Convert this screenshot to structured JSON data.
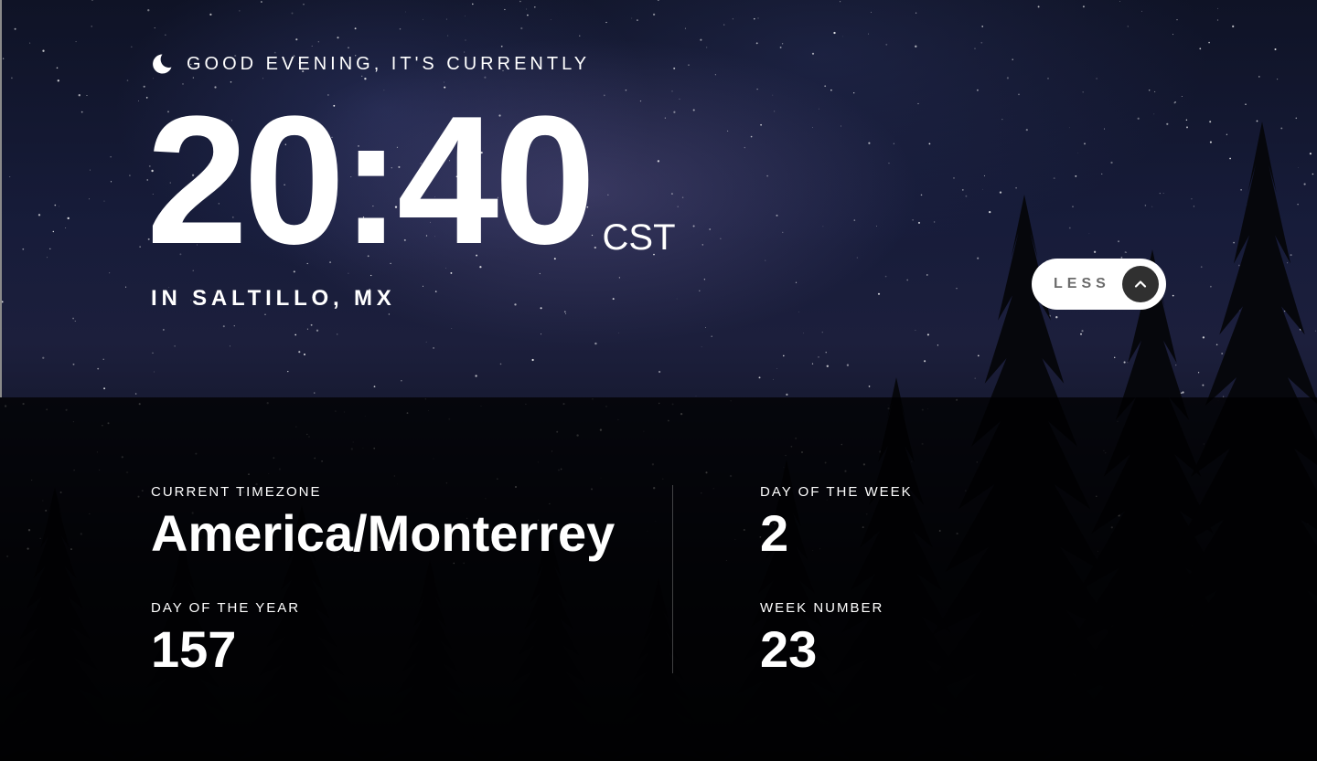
{
  "greeting": {
    "icon": "moon-icon",
    "text": "GOOD EVENING, IT'S CURRENTLY"
  },
  "clock": {
    "time": "20:40",
    "abbreviation": "CST"
  },
  "location": "IN SALTILLO, MX",
  "toggle": {
    "label": "LESS",
    "icon": "chevron-up-icon"
  },
  "details": {
    "timezone": {
      "label": "CURRENT TIMEZONE",
      "value": "America/Monterrey"
    },
    "day_of_year": {
      "label": "DAY OF THE YEAR",
      "value": "157"
    },
    "day_of_week": {
      "label": "DAY OF THE WEEK",
      "value": "2"
    },
    "week_number": {
      "label": "WEEK NUMBER",
      "value": "23"
    }
  },
  "colors": {
    "text": "#ffffff",
    "toggle_bg": "#ffffff",
    "toggle_label": "#6b6b6b",
    "toggle_button": "#303030",
    "panel_bg": "rgba(0,0,0,0.75)"
  }
}
